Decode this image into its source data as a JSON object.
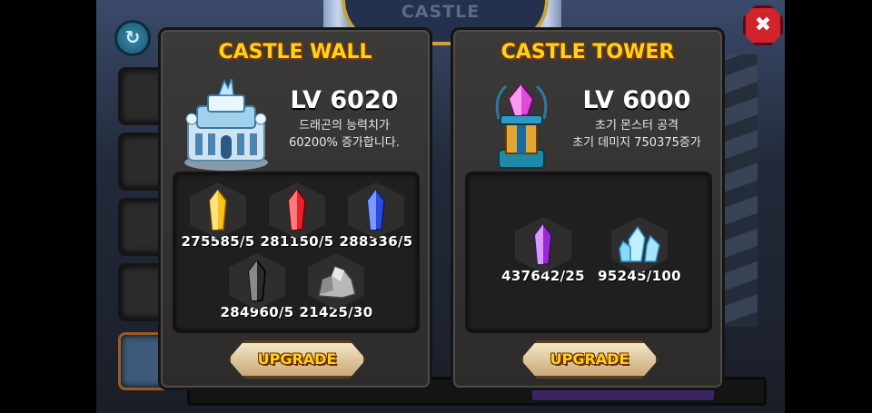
{
  "scene": {
    "title": "CASTLE"
  },
  "icons": {
    "refresh": "refresh-icon",
    "close": "close-icon"
  },
  "close_label": "✖",
  "refresh_label": "↻",
  "colors": {
    "title_gold": "#ffd21a",
    "close_red": "#d0232b",
    "panel_bg": "#3b3a38"
  },
  "wall": {
    "title": "CASTLE WALL",
    "level": "LV 6020",
    "desc_line1": "드래곤의 능력치가",
    "desc_line2": "60200% 증가합니다.",
    "materials": [
      {
        "icon": "yellow-crystal-icon",
        "count": "275585/5"
      },
      {
        "icon": "red-crystal-icon",
        "count": "281150/5"
      },
      {
        "icon": "blue-crystal-icon",
        "count": "288336/5"
      },
      {
        "icon": "black-crystal-icon",
        "count": "284960/5"
      },
      {
        "icon": "stone-ore-icon",
        "count": "21425/30"
      }
    ],
    "upgrade_label": "UPGRADE"
  },
  "tower": {
    "title": "CASTLE TOWER",
    "level": "LV 6000",
    "desc_line1": "초기 몬스터 공격",
    "desc_line2": "초기 데미지 750375증가",
    "materials": [
      {
        "icon": "purple-crystal-icon",
        "count": "437642/25"
      },
      {
        "icon": "ice-crystal-icon",
        "count": "95245/100"
      }
    ],
    "upgrade_label": "UPGRADE"
  }
}
